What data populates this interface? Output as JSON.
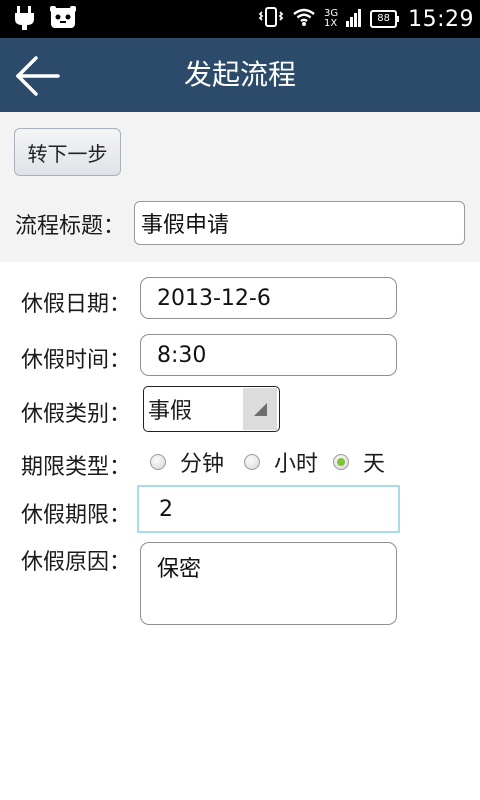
{
  "status_bar": {
    "time": "15:29",
    "network_top": "3G",
    "network_bottom": "1X",
    "battery": "88"
  },
  "header": {
    "title": "发起流程"
  },
  "toolbar": {
    "next_step_label": "转下一步"
  },
  "form": {
    "flow_title": {
      "label": "流程标题：",
      "value": "事假申请"
    },
    "leave_date": {
      "label": "休假日期：",
      "value": "2013-12-6"
    },
    "leave_time": {
      "label": "休假时间：",
      "value": "8:30"
    },
    "leave_type": {
      "label": "休假类别：",
      "value": "事假"
    },
    "period_type": {
      "label": "期限类型：",
      "options": [
        {
          "label": "分钟",
          "checked": false
        },
        {
          "label": "小时",
          "checked": false
        },
        {
          "label": "天",
          "checked": true
        }
      ]
    },
    "leave_period": {
      "label": "休假期限：",
      "value": "2"
    },
    "leave_reason": {
      "label": "休假原因：",
      "value": "保密"
    }
  },
  "colors": {
    "title_bar": "#2c4b6a",
    "radio_checked": "#7ec33a",
    "focus_border": "#a8dce6"
  }
}
